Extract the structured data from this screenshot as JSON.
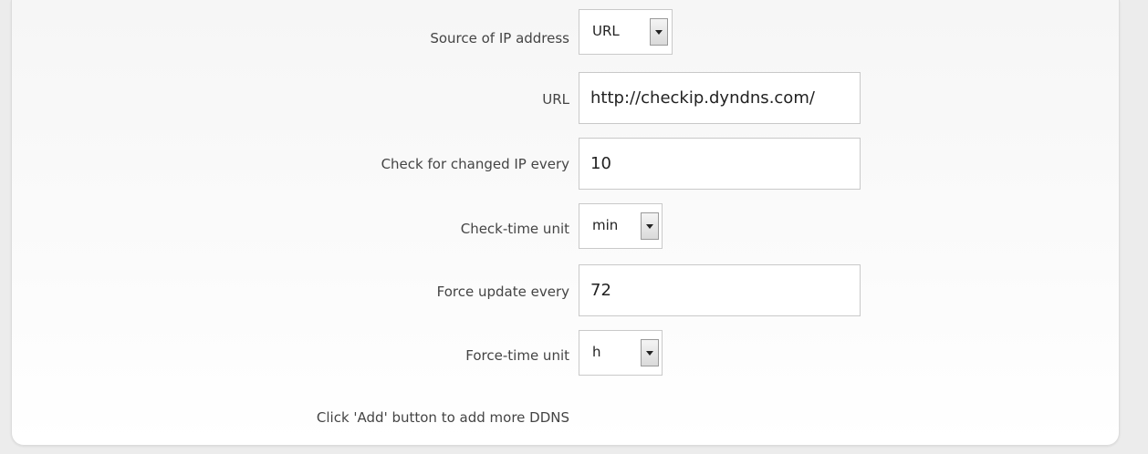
{
  "form": {
    "source_label": "Source of IP address",
    "source_value": "URL",
    "url_label": "URL",
    "url_value": "http://checkip.dyndns.com/",
    "check_label": "Check for changed IP every",
    "check_value": "10",
    "check_unit_label": "Check-time unit",
    "check_unit_value": "min",
    "force_label": "Force update every",
    "force_value": "72",
    "force_unit_label": "Force-time unit",
    "force_unit_value": "h",
    "hint": "Click 'Add' button to add more DDNS"
  },
  "icons": {
    "dropdown": "chevron-down-icon"
  }
}
